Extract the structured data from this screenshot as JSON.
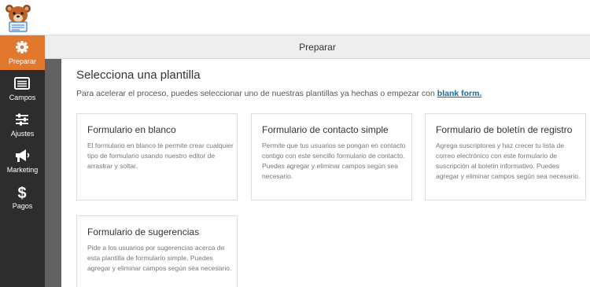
{
  "app": {
    "logo_name": "wpforms-bear-logo"
  },
  "colors": {
    "accent": "#e2772e",
    "sidebar_bg": "#2d2d2d",
    "link": "#0e6fa8",
    "header_bg": "#eeeeee"
  },
  "sidebar": {
    "items": [
      {
        "label": "Preparar",
        "icon": "gear-icon",
        "active": true
      },
      {
        "label": "Campos",
        "icon": "fields-list-icon",
        "active": false
      },
      {
        "label": "Ajustes",
        "icon": "sliders-icon",
        "active": false
      },
      {
        "label": "Marketing",
        "icon": "megaphone-icon",
        "active": false
      },
      {
        "label": "Pagos",
        "icon": "dollar-icon",
        "active": false
      }
    ]
  },
  "header": {
    "title": "Preparar"
  },
  "main": {
    "heading": "Selecciona una plantilla",
    "subtitle_text": "Para acelerar el proceso, puedes seleccionar uno de nuestras plantillas ya hechas o empezar con",
    "subtitle_link": "blank form.",
    "templates": [
      {
        "title": "Formulario en blanco",
        "description": "El formulario en blanco te permite crear cualquier tipo de formulario usando nuestro editor de arrastrar y soltar."
      },
      {
        "title": "Formulario de contacto simple",
        "description": "Permite que tus usuarios se pongan en contacto contigo con este sencillo formulario de contacto. Puedes agregar y eliminar campos según sea necesario."
      },
      {
        "title": "Formulario de boletín de registro",
        "description": "Agrega suscriptores y haz crecer tu lista de correo electrónico con este formulario de suscripción al boletín informativo. Puedes agregar y eliminar campos según sea necesario."
      },
      {
        "title": "Formulario de sugerencias",
        "description": "Pide a los usuarios por sugerencias acerca de esta plantilla de formulario simple. Puedes agregar y eliminar campos según sea necesario."
      }
    ]
  }
}
